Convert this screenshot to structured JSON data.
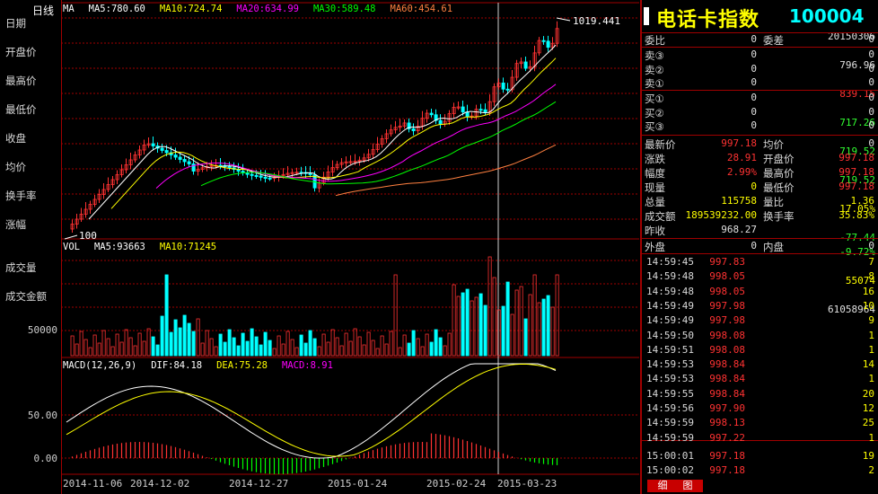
{
  "left_panel": {
    "period": "日线",
    "items": [
      {
        "label": "日期",
        "value": "20150306",
        "color": "#e0e0e0"
      },
      {
        "label": "开盘价",
        "value": "796.96",
        "color": "#e0e0e0"
      },
      {
        "label": "最高价",
        "value": "839.15",
        "color": "#ff3232"
      },
      {
        "label": "最低价",
        "value": "717.26",
        "color": "#32ff32"
      },
      {
        "label": "收盘",
        "value": "719.52",
        "color": "#32ff32"
      },
      {
        "label": "均价",
        "value": "719.52",
        "color": "#32ff32"
      },
      {
        "label": "换手率",
        "value": "17.05%",
        "color": "#ffff00"
      },
      {
        "label": "涨幅",
        "value": "-77.44",
        "value2": "-9.72%",
        "color": "#32ff32"
      },
      {
        "label": "成交量",
        "value": "55074",
        "color": "#ffff00"
      },
      {
        "label": "成交金额",
        "value": "61058964",
        "color": "#e0e0e0"
      }
    ]
  },
  "price_legend": [
    {
      "text": "MA",
      "color": "#ffffff"
    },
    {
      "text": "MA5:780.60",
      "color": "#ffffff"
    },
    {
      "text": "MA10:724.74",
      "color": "#ffff00"
    },
    {
      "text": "MA20:634.99",
      "color": "#ff00ff"
    },
    {
      "text": "MA30:589.48",
      "color": "#00ff00"
    },
    {
      "text": "MA60:454.61",
      "color": "#ff8040"
    }
  ],
  "price_annotations": {
    "high": "1019.441",
    "low": "100"
  },
  "vol_legend": [
    {
      "text": "VOL",
      "color": "#ffffff"
    },
    {
      "text": "MA5:93663",
      "color": "#ffffff"
    },
    {
      "text": "MA10:71245",
      "color": "#ffff00"
    }
  ],
  "vol_axis": {
    "tick": "50000"
  },
  "macd_legend": [
    {
      "text": "MACD(12,26,9)",
      "color": "#ffffff"
    },
    {
      "text": "DIF:84.18",
      "color": "#ffffff"
    },
    {
      "text": "DEA:75.28",
      "color": "#ffff00"
    },
    {
      "text": "MACD:8.91",
      "color": "#ff00ff"
    }
  ],
  "macd_axis": {
    "ticks": [
      "50.00",
      "0.00"
    ]
  },
  "date_axis": [
    "2014-11-06",
    "2014-12-02",
    "2014-12-27",
    "2015-01-24",
    "2015-02-24",
    "2015-03-23"
  ],
  "quote": {
    "name": "电话卡指数",
    "code": "100004",
    "order_ratio_label": "委比",
    "order_ratio_value": "0",
    "order_diff_label": "委差",
    "order_diff_value": "0",
    "asks": [
      {
        "label": "卖③",
        "price": "0",
        "vol": "0"
      },
      {
        "label": "卖②",
        "price": "0",
        "vol": "0"
      },
      {
        "label": "卖①",
        "price": "0",
        "vol": "0"
      }
    ],
    "bids": [
      {
        "label": "买①",
        "price": "0",
        "vol": "0"
      },
      {
        "label": "买②",
        "price": "0",
        "vol": "0"
      },
      {
        "label": "买③",
        "price": "0",
        "vol": "0"
      }
    ],
    "stats_left": [
      {
        "label": "最新价",
        "value": "997.18",
        "color": "#ff3232"
      },
      {
        "label": "涨跌",
        "value": "28.91",
        "color": "#ff3232"
      },
      {
        "label": "幅度",
        "value": "2.99%",
        "color": "#ff3232"
      },
      {
        "label": "现量",
        "value": "0",
        "color": "#ffff00"
      },
      {
        "label": "总量",
        "value": "115758",
        "color": "#ffff00"
      },
      {
        "label": "成交额",
        "value": "189539232.00",
        "color": "#ffff00"
      },
      {
        "label": "昨收",
        "value": "968.27",
        "color": "#e0e0e0"
      }
    ],
    "stats_right": [
      {
        "label": "均价",
        "value": "0",
        "color": "#e0e0e0"
      },
      {
        "label": "开盘价",
        "value": "997.18",
        "color": "#ff3232"
      },
      {
        "label": "最高价",
        "value": "997.18",
        "color": "#ff3232"
      },
      {
        "label": "最低价",
        "value": "997.18",
        "color": "#ff3232"
      },
      {
        "label": "量比",
        "value": "1.36",
        "color": "#ffff00"
      },
      {
        "label": "换手率",
        "value": "35.83%",
        "color": "#ffff00"
      }
    ],
    "outer_label": "外盘",
    "outer_value": "0",
    "inner_label": "内盘",
    "inner_value": "0"
  },
  "ticks": [
    {
      "time": "14:59:45",
      "price": "997.83",
      "vol": "7",
      "color": "#ffff00"
    },
    {
      "time": "14:59:48",
      "price": "998.05",
      "vol": "8",
      "color": "#ffff00"
    },
    {
      "time": "14:59:48",
      "price": "998.05",
      "vol": "16",
      "color": "#ffff00"
    },
    {
      "time": "14:59:49",
      "price": "997.98",
      "vol": "10",
      "color": "#ffff00"
    },
    {
      "time": "14:59:49",
      "price": "997.98",
      "vol": "9",
      "color": "#ffff00"
    },
    {
      "time": "14:59:50",
      "price": "998.08",
      "vol": "1",
      "color": "#ffff00"
    },
    {
      "time": "14:59:51",
      "price": "998.08",
      "vol": "1",
      "color": "#ffff00"
    },
    {
      "time": "14:59:53",
      "price": "998.84",
      "vol": "14",
      "color": "#ffff00"
    },
    {
      "time": "14:59:53",
      "price": "998.84",
      "vol": "1",
      "color": "#ffff00"
    },
    {
      "time": "14:59:55",
      "price": "998.84",
      "vol": "20",
      "color": "#ffff00"
    },
    {
      "time": "14:59:56",
      "price": "997.90",
      "vol": "12",
      "color": "#ffff00"
    },
    {
      "time": "14:59:59",
      "price": "998.13",
      "vol": "25",
      "color": "#ffff00"
    },
    {
      "time": "14:59:59",
      "price": "997.22",
      "vol": "1",
      "color": "#ffff00"
    },
    {
      "time": "15:00:01",
      "price": "997.18",
      "vol": "19",
      "color": "#ffff00"
    },
    {
      "time": "15:00:02",
      "price": "997.18",
      "vol": "2",
      "color": "#ffff00"
    }
  ],
  "tabs": [
    "细",
    "图"
  ],
  "colors": {
    "up": "#ff3232",
    "down": "#00ffff",
    "grid": "#a00000"
  }
}
